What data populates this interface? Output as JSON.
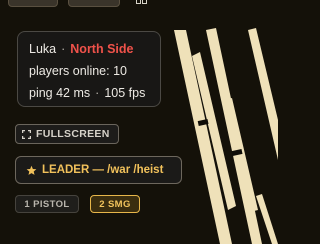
{
  "info_card": {
    "player_name": "Luka",
    "separator": "·",
    "server_name": "North Side",
    "players_online_label": "players online: 10",
    "ping_label": "ping 42 ms",
    "fps_label": "105 fps"
  },
  "fullscreen_button": {
    "icon": "fullscreen-icon",
    "label": "FULLSCREEN"
  },
  "leader_badge": {
    "icon": "star-icon",
    "label": "LEADER — /war /heist"
  },
  "weapon_slots": [
    {
      "label": "1 PISTOL",
      "active": false
    },
    {
      "label": "2 SMG",
      "active": true
    }
  ],
  "colors": {
    "background": "#141109",
    "stripe": "#efe1b9",
    "server_name": "#f0524a",
    "accent_gold": "#f1c15b"
  }
}
